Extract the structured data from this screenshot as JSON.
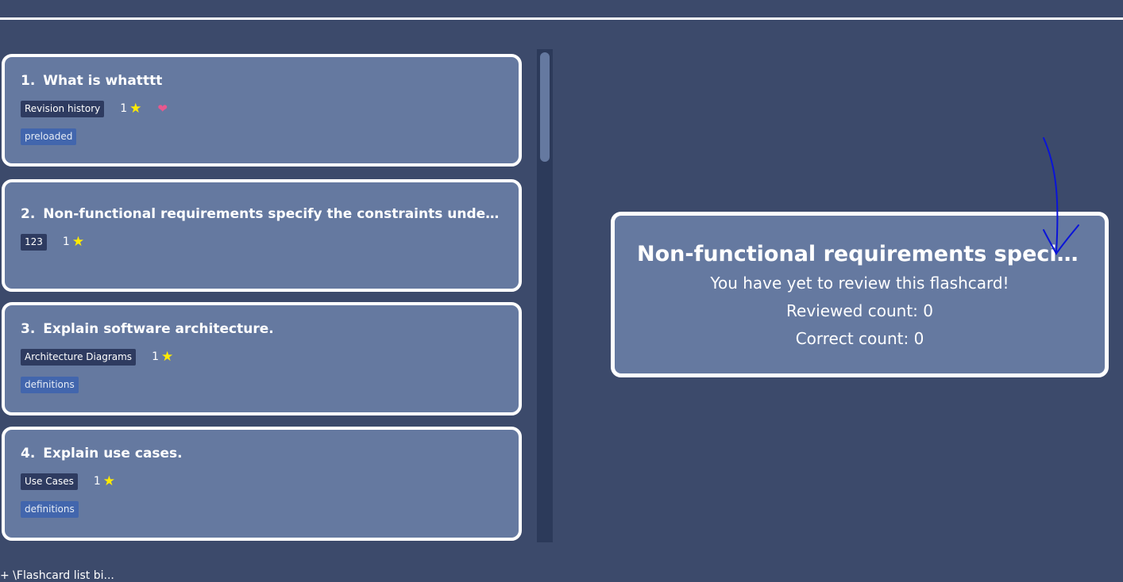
{
  "flashcards": [
    {
      "number": "1.",
      "question": "What is whatttt",
      "category": "Revision history",
      "rating": "1",
      "favourite": true,
      "tag": "preloaded"
    },
    {
      "number": "2.",
      "question": "Non-functional requirements specify the constraints under whi...",
      "category": "123",
      "rating": "1",
      "favourite": false,
      "tag": ""
    },
    {
      "number": "3.",
      "question": "Explain software architecture.",
      "category": "Architecture Diagrams",
      "rating": "1",
      "favourite": false,
      "tag": "definitions"
    },
    {
      "number": "4.",
      "question": "Explain use cases.",
      "category": "Use Cases",
      "rating": "1",
      "favourite": false,
      "tag": "definitions"
    }
  ],
  "detail": {
    "title": "Non-functional requirements specify ...",
    "review_status": "You have yet to review this flashcard!",
    "reviewed_count": "Reviewed count: 0",
    "correct_count": "Correct count: 0"
  },
  "icons": {
    "star": "star-icon",
    "heart": "heart-icon"
  },
  "colors": {
    "background": "#3c4a6b",
    "card": "#6579a0",
    "category_badge": "#2e3b60",
    "tag_badge": "#4266ad",
    "star": "#ffeb00",
    "heart": "#e8588e",
    "annotation_arrow": "#0a14d8"
  },
  "status_bar": {
    "text": "+ \\Flashcard list bi..."
  }
}
